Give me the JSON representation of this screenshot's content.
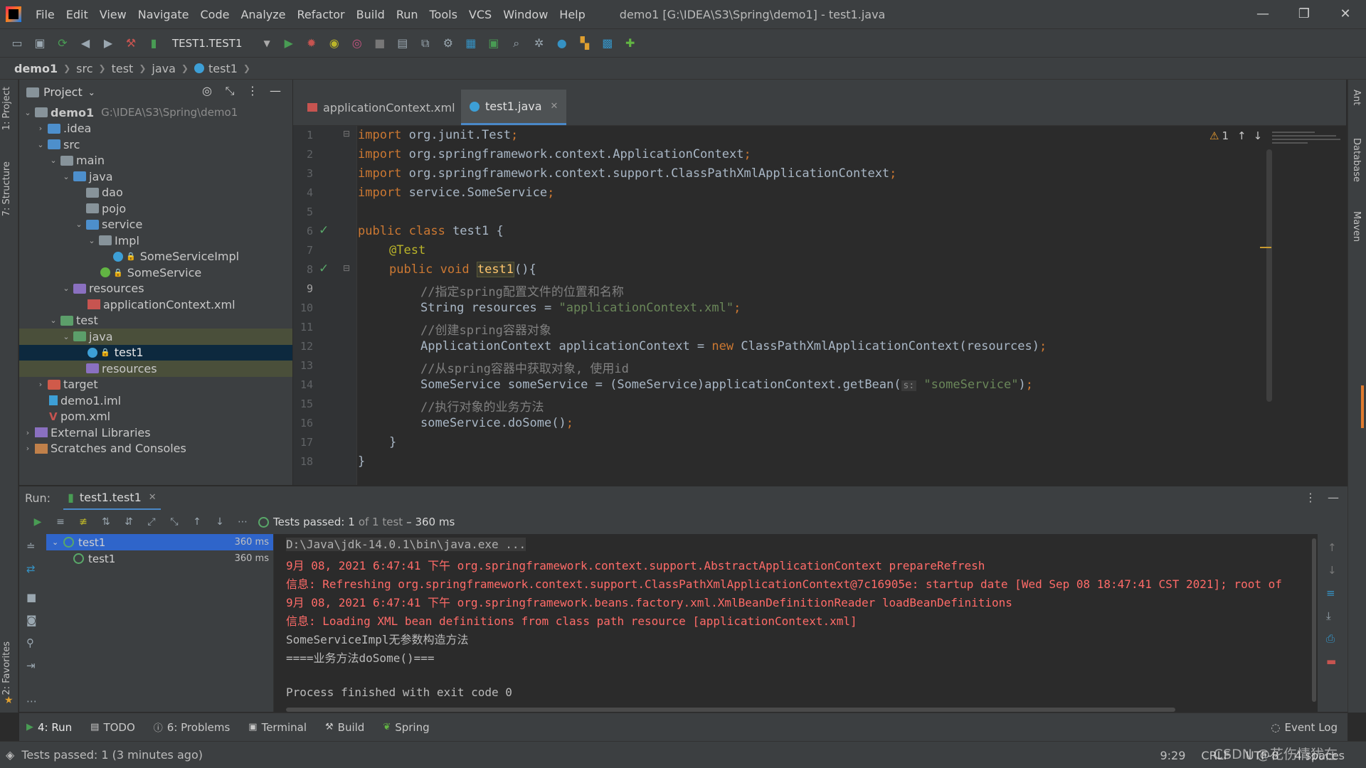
{
  "window": {
    "title": "demo1 [G:\\IDEA\\S3\\Spring\\demo1] - test1.java",
    "controls": [
      "—",
      "❐",
      "✕"
    ]
  },
  "menu": [
    "File",
    "Edit",
    "View",
    "Navigate",
    "Code",
    "Analyze",
    "Refactor",
    "Build",
    "Run",
    "Tools",
    "VCS",
    "Window",
    "Help"
  ],
  "toolbar": {
    "run_config": "TEST1.TEST1"
  },
  "breadcrumb": [
    "demo1",
    "src",
    "test",
    "java",
    "test1"
  ],
  "left_stripe": {
    "project_tab": "1: Project",
    "structure_tab": "7: Structure",
    "favorites_tab": "2: Favorites"
  },
  "right_stripe": {
    "ant": "Ant",
    "database": "Database",
    "maven": "Maven"
  },
  "project": {
    "header": "Project",
    "root_name": "demo1",
    "root_path": "G:\\IDEA\\S3\\Spring\\demo1",
    "items": [
      ".idea",
      "src",
      "main",
      "java",
      "dao",
      "pojo",
      "service",
      "Impl",
      "SomeServiceImpl",
      "SomeService",
      "resources",
      "applicationContext.xml",
      "test",
      "java",
      "test1",
      "resources",
      "target",
      "demo1.iml",
      "pom.xml",
      "External Libraries",
      "Scratches and Consoles"
    ]
  },
  "editor": {
    "tabs": [
      {
        "label": "applicationContext.xml"
      },
      {
        "label": "test1.java"
      }
    ],
    "warning_count": "1",
    "line_numbers": [
      "1",
      "2",
      "3",
      "4",
      "5",
      "6",
      "7",
      "8",
      "9",
      "10",
      "11",
      "12",
      "13",
      "14",
      "15",
      "16",
      "17",
      "18"
    ],
    "code": {
      "l1_kw": "import",
      "l1_rest": " org.junit.Test",
      "l2_kw": "import",
      "l2_rest": " org.springframework.context.ApplicationContext",
      "l3_kw": "import",
      "l3_rest": " org.springframework.context.support.ClassPathXmlApplicationContext",
      "l4_kw": "import",
      "l4_rest": " service.SomeService",
      "l6_kw": "public class",
      "l6_rest": " test1 {",
      "l7_an": "@Test",
      "l8_kw": "public void",
      "l8_fn": "test1",
      "l8_rest": "(){",
      "l9_cm": "//指定spring配置文件的位置和名称",
      "l10_a": "String resources = ",
      "l10_st": "\"applicationContext.xml\"",
      "l11_cm": "//创建spring容器对象",
      "l12_a": "ApplicationContext applicationContext = ",
      "l12_kw": "new",
      "l12_b": " ClassPathXmlApplicationContext(resources)",
      "l13_cm": "//从spring容器中获取对象, 使用id",
      "l14_a": "SomeService someService = (SomeService)applicationContext.getBean(",
      "l14_hint": "s:",
      "l14_st": "\"someService\"",
      "l14_b": ")",
      "l15_cm": "//执行对象的业务方法",
      "l16_a": "someService.doSome()",
      "l17": "}",
      "l18": "}"
    }
  },
  "run": {
    "label": "Run:",
    "tab": "test1.test1",
    "status_passed": "Tests passed:",
    "status_count": "1",
    "status_of": "of 1 test",
    "status_time": "– 360 ms",
    "tree": [
      {
        "name": "test1",
        "time": "360 ms"
      },
      {
        "name": "test1",
        "time": "360 ms"
      }
    ],
    "console": [
      "D:\\Java\\jdk-14.0.1\\bin\\java.exe ...",
      "9月 08, 2021 6:47:41 下午 org.springframework.context.support.AbstractApplicationContext prepareRefresh",
      "信息: Refreshing org.springframework.context.support.ClassPathXmlApplicationContext@7c16905e: startup date [Wed Sep 08 18:47:41 CST 2021]; root of",
      "9月 08, 2021 6:47:41 下午 org.springframework.beans.factory.xml.XmlBeanDefinitionReader loadBeanDefinitions",
      "信息: Loading XML bean definitions from class path resource [applicationContext.xml]",
      "SomeServiceImpl无参数构造方法",
      "====业务方法doSome()===",
      "",
      "Process finished with exit code 0"
    ]
  },
  "bottom_tabs": [
    "4: Run",
    "TODO",
    "6: Problems",
    "Terminal",
    "Build",
    "Spring"
  ],
  "event_log": "Event Log",
  "status": {
    "message": "Tests passed: 1 (3 minutes ago)",
    "position": "9:29",
    "line_sep": "CRLF",
    "encoding": "UTF-8",
    "indent": "4 spaces"
  },
  "watermark": "CSDN @花伤情犹在",
  "colors": {
    "accent": "#4a88c7",
    "keyword": "#cc7832",
    "string": "#6a8759",
    "comment": "#808080",
    "error": "#ff6b68",
    "success": "#59a869"
  }
}
